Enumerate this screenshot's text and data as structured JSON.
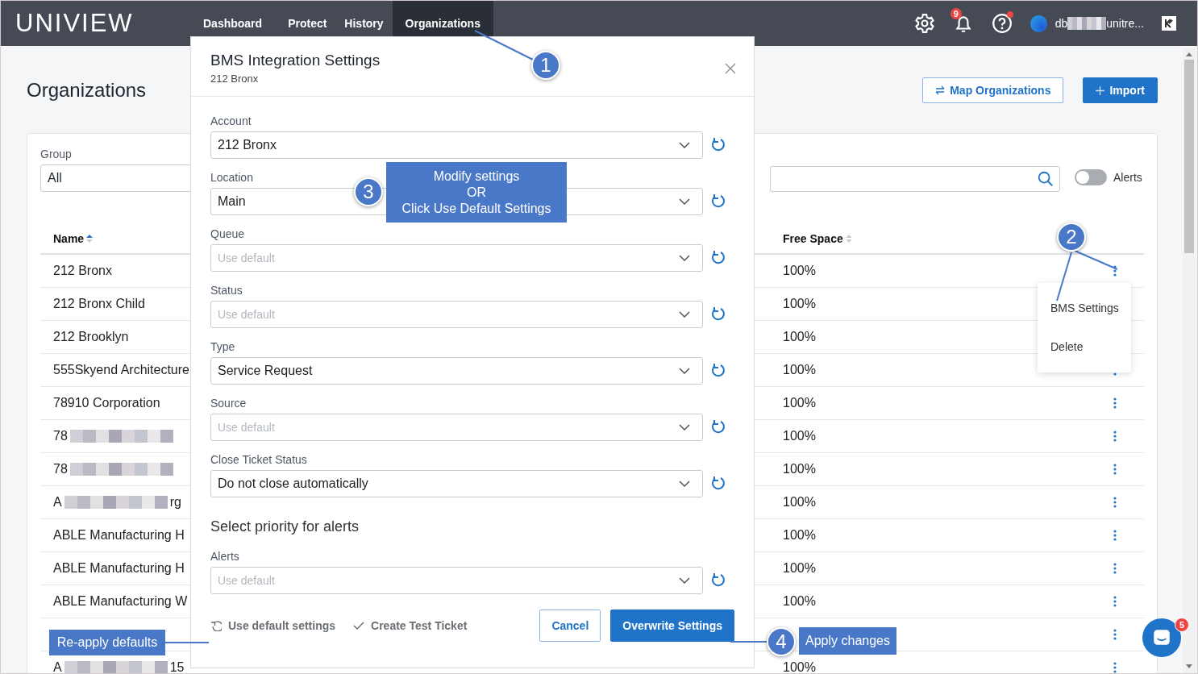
{
  "header": {
    "logo": "**UNI**VIEW",
    "nav": [
      {
        "label": "Dashboard",
        "selected": false
      },
      {
        "label": "Protect",
        "selected": false
      },
      {
        "label": "History",
        "selected": false
      },
      {
        "label": "Organizations",
        "selected": true
      }
    ],
    "notification_count": "9",
    "help_alert": true,
    "user": {
      "name_start": "db",
      "redacted": true,
      "name_end": "unitre..."
    }
  },
  "page": {
    "title": "Organizations",
    "buttons": [
      {
        "kind": "outline",
        "label": "Map Organizations"
      },
      {
        "kind": "primary",
        "label": "Import"
      }
    ]
  },
  "filters": {
    "group_label": "Group",
    "group_value": "All",
    "alerts_toggle": {
      "label": "Alerts",
      "on": false
    }
  },
  "table": {
    "columns": [
      "Name",
      "Free Space"
    ],
    "rows": [
      {
        "name": "212 Bronx",
        "free_space": "100%"
      },
      {
        "name": "212 Bronx Child",
        "free_space": "100%"
      },
      {
        "name": "212 Brooklyn",
        "free_space": "100%"
      },
      {
        "name": "555Skyend Architecture",
        "free_space": "100%"
      },
      {
        "name": "78910 Corporation",
        "free_space": "100%"
      },
      {
        "name": "78",
        "redacted": true,
        "free_space": "100%"
      },
      {
        "name": "78",
        "redacted": true,
        "free_space": "100%"
      },
      {
        "name": "A",
        "redacted": true,
        "name_end": "rg",
        "free_space": "100%"
      },
      {
        "name": "ABLE Manufacturing H",
        "free_space": "100%"
      },
      {
        "name": "ABLE Manufacturing H",
        "free_space": "100%"
      },
      {
        "name": "ABLE Manufacturing W",
        "free_space": "100%"
      },
      {},
      {
        "name": "A",
        "redacted": true,
        "name_end": "15",
        "free_space": "100%"
      }
    ],
    "row_menu": [
      "BMS Settings",
      "Delete"
    ]
  },
  "modal": {
    "title": "BMS Integration Settings",
    "subtitle": "212 Bronx",
    "items": [
      {
        "kind": "field",
        "label": "Account",
        "value": "212 Bronx"
      },
      {
        "kind": "field",
        "label": "Location",
        "value": "Main"
      },
      {
        "kind": "field",
        "label": "Queue",
        "placeholder": "Use default"
      },
      {
        "kind": "field",
        "label": "Status",
        "placeholder": "Use default"
      },
      {
        "kind": "field",
        "label": "Type",
        "value": "Service Request"
      },
      {
        "kind": "field",
        "label": "Source",
        "placeholder": "Use default"
      },
      {
        "kind": "field",
        "label": "Close Ticket Status",
        "value": "Do not close automatically"
      },
      {
        "kind": "heading",
        "label": "Select priority for alerts"
      },
      {
        "kind": "field",
        "label": "Alerts",
        "placeholder": "Use default"
      }
    ],
    "links": [
      {
        "kind": "reset",
        "label": "Use default settings"
      },
      {
        "kind": "check",
        "label": "Create Test Ticket"
      }
    ],
    "buttons": [
      {
        "kind": "outline",
        "label": "Cancel"
      },
      {
        "kind": "primary",
        "label": "Overwrite Settings"
      }
    ]
  },
  "chat_badge": "5",
  "annotations": [
    {
      "number": "1"
    },
    {
      "number": "3",
      "note": "Modify settings\nOR\nClick Use Default Settings"
    },
    {
      "number": "2"
    },
    {
      "note": "Re-apply defaults"
    },
    {
      "number": "4",
      "note": "Apply changes"
    }
  ]
}
